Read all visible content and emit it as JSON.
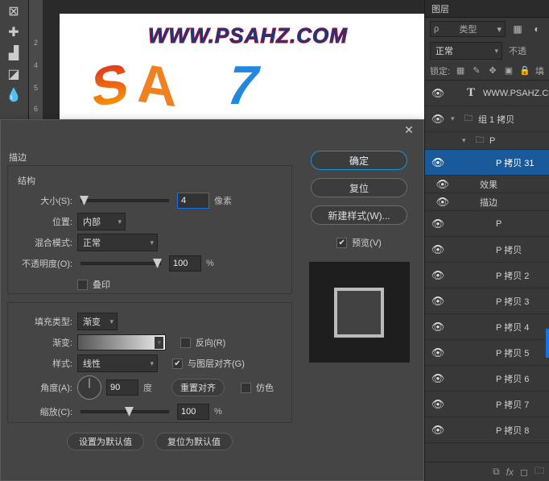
{
  "toolbar": {
    "tools": [
      "crop",
      "heal",
      "stamp",
      "eraser",
      "drop"
    ]
  },
  "canvas": {
    "watermark": "WWW.PSAHZ.COM"
  },
  "dialog": {
    "section_stroke": "描边",
    "section_struct": "结构",
    "size_label": "大小(S):",
    "size_value": "4",
    "size_unit": "像素",
    "position_label": "位置:",
    "position_value": "内部",
    "blend_label": "混合模式:",
    "blend_value": "正常",
    "opacity_label": "不透明度(O):",
    "opacity_value": "100",
    "opacity_unit": "%",
    "overprint_label": "叠印",
    "fill_label": "填充类型:",
    "fill_value": "渐变",
    "gradient_label": "渐变:",
    "reverse_label": "反向(R)",
    "style_label": "样式:",
    "style_value": "线性",
    "align_label": "与图层对齐(G)",
    "angle_label": "角度(A):",
    "angle_value": "90",
    "angle_unit": "度",
    "reset_align": "重置对齐",
    "dither_label": "仿色",
    "scale_label": "缩放(C):",
    "scale_value": "100",
    "scale_unit": "%",
    "set_default": "设置为默认值",
    "reset_default": "复位为默认值",
    "btn_ok": "确定",
    "btn_cancel": "复位",
    "btn_newstyle": "新建样式(W)...",
    "preview_label": "预览(V)"
  },
  "layers": {
    "tab": "图层",
    "search_type": "类型",
    "blend_mode": "正常",
    "opacity_word": "不透",
    "lock_label": "锁定:",
    "lock_fill": "填",
    "items": [
      {
        "name": "WWW.PSAHZ.CO"
      },
      {
        "name": "组 1 拷贝"
      },
      {
        "name": "P"
      },
      {
        "name": "P 拷贝 31"
      },
      {
        "name": "效果"
      },
      {
        "name": "描边"
      },
      {
        "name": "P"
      },
      {
        "name": "P 拷贝"
      },
      {
        "name": "P 拷贝 2"
      },
      {
        "name": "P 拷贝 3"
      },
      {
        "name": "P 拷贝 4"
      },
      {
        "name": "P 拷贝 5"
      },
      {
        "name": "P 拷贝 6"
      },
      {
        "name": "P 拷贝 7"
      },
      {
        "name": "P 拷贝 8"
      }
    ]
  }
}
